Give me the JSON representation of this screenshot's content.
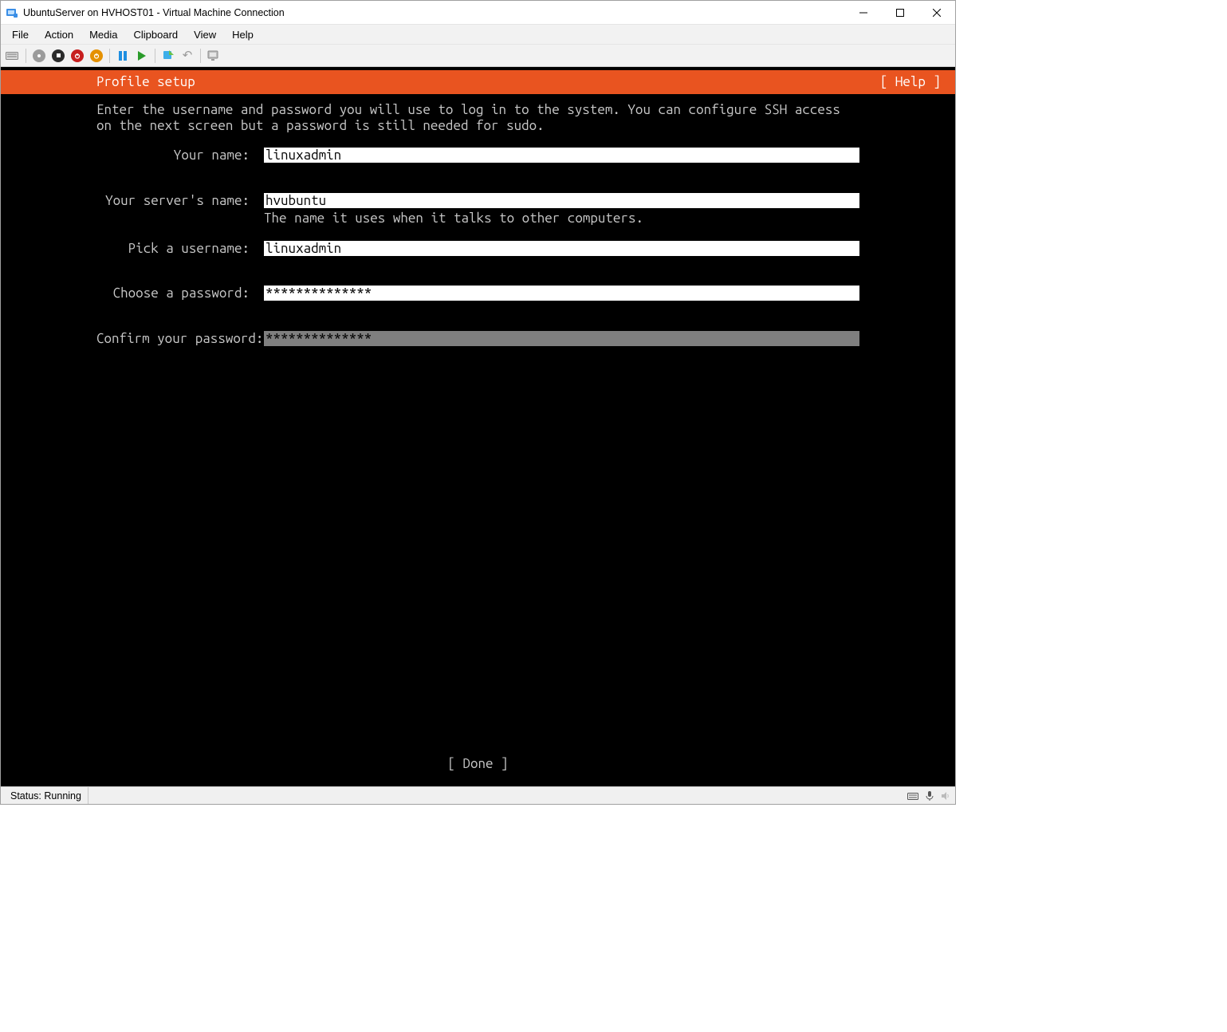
{
  "window": {
    "title": "UbuntuServer on HVHOST01 - Virtual Machine Connection"
  },
  "menu": {
    "file": "File",
    "action": "Action",
    "media": "Media",
    "clipboard": "Clipboard",
    "view": "View",
    "help": "Help"
  },
  "installer": {
    "header_title": "Profile setup",
    "help_label": "[ Help ]",
    "description": "Enter the username and password you will use to log in to the system. You can configure SSH access on the next screen but a password is still needed for sudo.",
    "fields": {
      "name": {
        "label": "Your name:",
        "value": "linuxadmin"
      },
      "server": {
        "label": "Your server's name:",
        "value": "hvubuntu",
        "hint": "The name it uses when it talks to other computers."
      },
      "username": {
        "label": "Pick a username:",
        "value": "linuxadmin"
      },
      "password": {
        "label": "Choose a password:",
        "value": "**************"
      },
      "confirm": {
        "label": "Confirm your password:",
        "value": "**************"
      }
    },
    "done_label": "[ Done       ]"
  },
  "status": {
    "label": "Status: Running"
  }
}
